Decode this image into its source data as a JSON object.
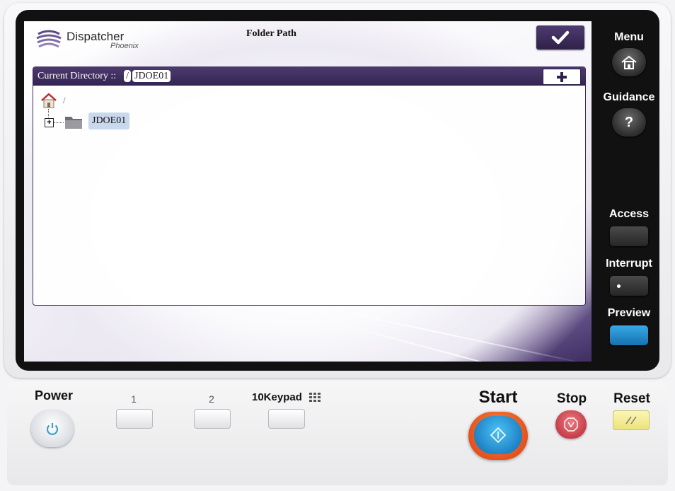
{
  "app": {
    "logo_text": "Dispatcher",
    "logo_subtext": "Phoenix",
    "page_title": "Folder Path"
  },
  "directory": {
    "label": "Current Directory ::",
    "path_root": "/",
    "path_current": "JDOE01",
    "root_label": "/",
    "folders": [
      {
        "name": "JDOE01",
        "expanded": false,
        "selected": true
      }
    ]
  },
  "hardware": {
    "menu_label": "Menu",
    "guidance_label": "Guidance",
    "guidance_glyph": "?",
    "access_label": "Access",
    "interrupt_label": "Interrupt",
    "preview_label": "Preview",
    "power_label": "Power",
    "key1_label": "1",
    "key2_label": "2",
    "keypad_label": "10Keypad",
    "start_label": "Start",
    "stop_label": "Stop",
    "reset_label": "Reset"
  },
  "colors": {
    "header_purple": "#3f2e60",
    "selection_blue": "#c9d8ec",
    "preview_blue": "#1e8fd0",
    "start_blue": "#1c8fd8",
    "stop_red": "#d2505a",
    "reset_yellow": "#f3ec9a"
  },
  "icons": {
    "ok": "checkmark-icon",
    "add": "plus-icon",
    "home": "home-icon",
    "folder": "folder-icon",
    "expand": "plus-box-icon",
    "keypad": "keypad-grid-icon",
    "power": "power-icon",
    "start": "start-diamond-icon",
    "stop": "stop-icon",
    "reset": "reset-icon"
  }
}
